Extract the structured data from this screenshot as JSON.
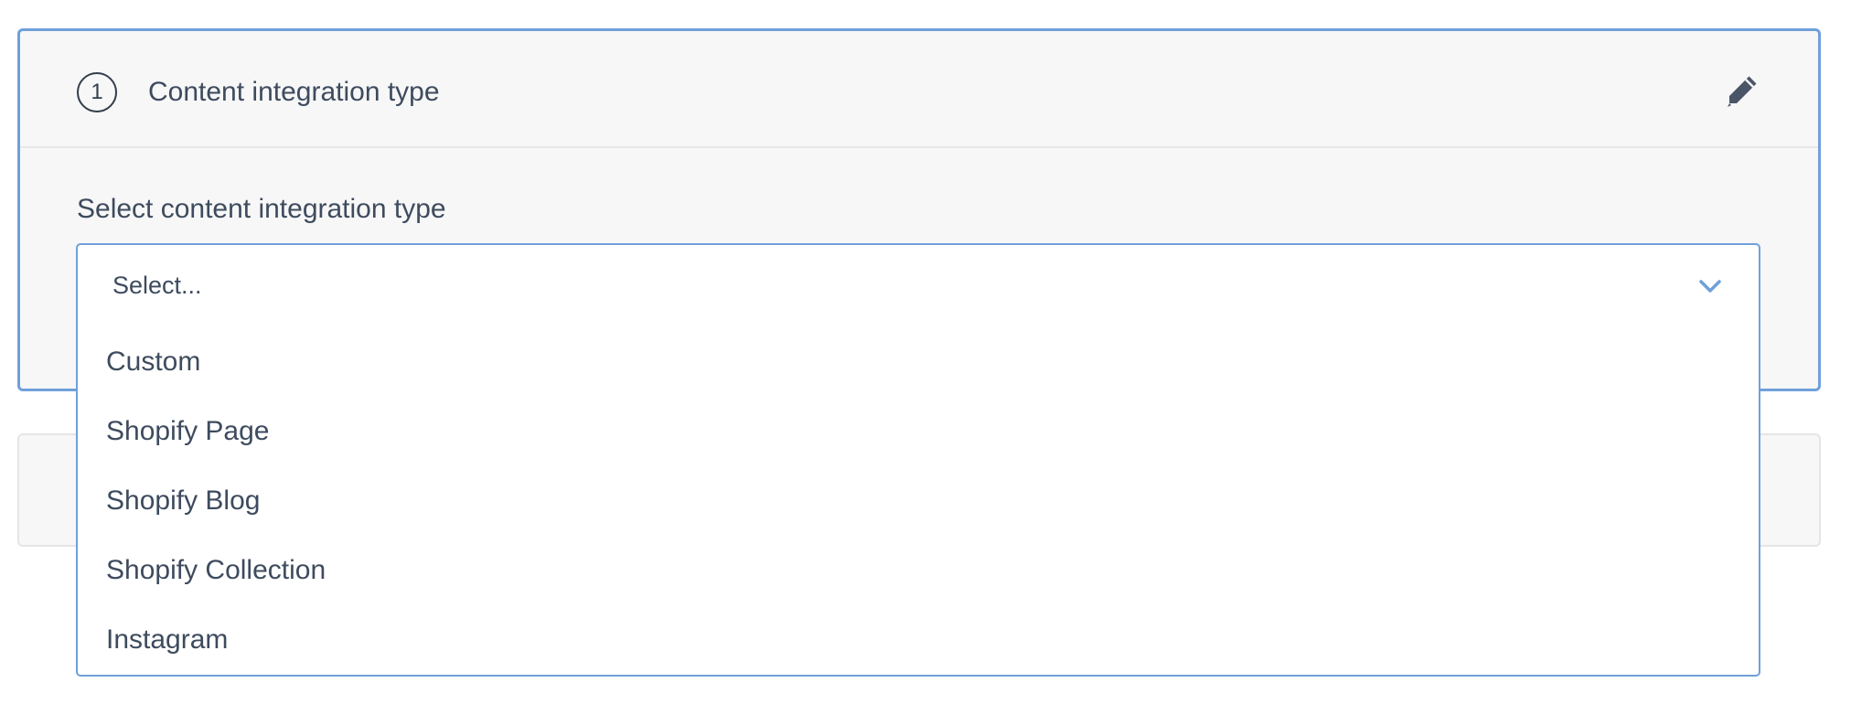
{
  "step1": {
    "number": "1",
    "title": "Content integration type",
    "edit_icon": "pencil-icon"
  },
  "field": {
    "label": "Select content integration type",
    "placeholder": "Select...",
    "chevron_icon": "chevron-down-icon",
    "options": [
      {
        "label": "Custom"
      },
      {
        "label": "Shopify Page"
      },
      {
        "label": "Shopify Blog"
      },
      {
        "label": "Shopify Collection"
      },
      {
        "label": "Instagram"
      }
    ]
  },
  "colors": {
    "accent": "#6fa0db",
    "text": "#3e4b5e",
    "icon": "#4a5568",
    "panel_bg": "#f7f7f7"
  }
}
